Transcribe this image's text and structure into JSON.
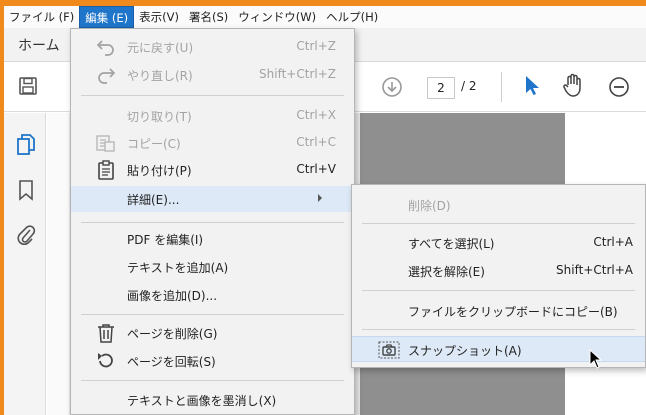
{
  "menubar": {
    "items": [
      {
        "label": "ファイル (F)",
        "active": false
      },
      {
        "label": "編集 (E)",
        "active": true
      },
      {
        "label": "表示(V)",
        "active": false
      },
      {
        "label": "署名(S)",
        "active": false
      },
      {
        "label": "ウィンドウ(W)",
        "active": false
      },
      {
        "label": "ヘルプ(H)",
        "active": false
      }
    ]
  },
  "tabbar": {
    "home_label": "ホーム"
  },
  "toolbar": {
    "page_current": "2",
    "page_total": "/ 2"
  },
  "edit_menu": {
    "undo": {
      "label": "元に戻す(U)",
      "shortcut": "Ctrl+Z"
    },
    "redo": {
      "label": "やり直し(R)",
      "shortcut": "Shift+Ctrl+Z"
    },
    "cut": {
      "label": "切り取り(T)",
      "shortcut": "Ctrl+X"
    },
    "copy": {
      "label": "コピー(C)",
      "shortcut": "Ctrl+C"
    },
    "paste": {
      "label": "貼り付け(P)",
      "shortcut": "Ctrl+V"
    },
    "more": {
      "label": "詳細(E)..."
    },
    "edit_pdf": {
      "label": "PDF を編集(I)"
    },
    "add_text": {
      "label": "テキストを追加(A)"
    },
    "add_image": {
      "label": "画像を追加(D)..."
    },
    "delete_page": {
      "label": "ページを削除(G)"
    },
    "rotate_page": {
      "label": "ページを回転(S)"
    },
    "redact": {
      "label": "テキストと画像を墨消し(X)"
    }
  },
  "submenu": {
    "delete": {
      "label": "削除(D)"
    },
    "select_all": {
      "label": "すべてを選択(L)",
      "shortcut": "Ctrl+A"
    },
    "deselect": {
      "label": "選択を解除(E)",
      "shortcut": "Shift+Ctrl+A"
    },
    "copy_file": {
      "label": "ファイルをクリップボードにコピー(B)"
    },
    "snapshot": {
      "label": "スナップショット(A)"
    }
  },
  "colors": {
    "accent": "#1f75c9",
    "brand_orange": "#f08a1c",
    "highlight": "#dde9f6"
  }
}
